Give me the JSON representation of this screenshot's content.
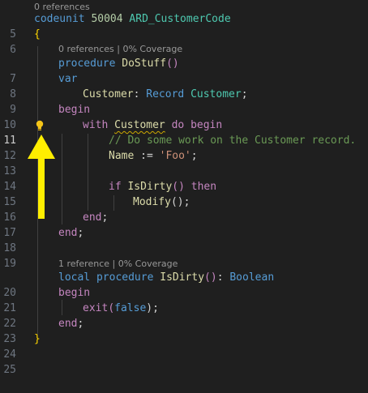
{
  "codelens": {
    "top": "0 references",
    "dostuff": "0 references | 0% Coverage",
    "isdirty": "1 reference | 0% Coverage"
  },
  "line_numbers": [
    "5",
    "6",
    "7",
    "8",
    "9",
    "10",
    "11",
    "12",
    "13",
    "14",
    "15",
    "16",
    "17",
    "18",
    "19",
    "20",
    "21",
    "22",
    "23",
    "24",
    "25"
  ],
  "code": {
    "l5": [
      "codeunit",
      "50004",
      "ARD_CustomerCode"
    ],
    "l6": "{",
    "l7": [
      "procedure",
      "DoStuff",
      "()"
    ],
    "l8": "var",
    "l9": [
      "Customer",
      ": ",
      "Record",
      "Customer",
      ";"
    ],
    "l10": "begin",
    "l11": [
      "with",
      "Customer",
      "do",
      "begin"
    ],
    "l12": "// Do some work on the Customer record.",
    "l13": [
      "Name",
      " := ",
      "'Foo'",
      ";"
    ],
    "l15": [
      "if",
      "IsDirty",
      "()",
      "then"
    ],
    "l16": [
      "Modify",
      "();"
    ],
    "l17": [
      "end",
      ";"
    ],
    "l18": [
      "end",
      ";"
    ],
    "l20": [
      "local",
      "procedure",
      "IsDirty",
      "()",
      ": ",
      "Boolean"
    ],
    "l21": "begin",
    "l22": [
      "exit",
      "(",
      "false",
      ");"
    ],
    "l23": [
      "end",
      ";"
    ],
    "l24": "}"
  },
  "colors": {
    "background": "#1f1f1f",
    "keyword": "#569cd6",
    "control": "#c586c0",
    "function": "#dcdcaa",
    "type": "#4ec9b0",
    "comment": "#6a9955",
    "string": "#ce9178",
    "bracket": "#ffd700",
    "arrow": "#ffee00",
    "lightbulb": "#f5c518"
  },
  "icons": {
    "lightbulb": "lightbulb-icon",
    "arrow": "annotation-arrow"
  }
}
